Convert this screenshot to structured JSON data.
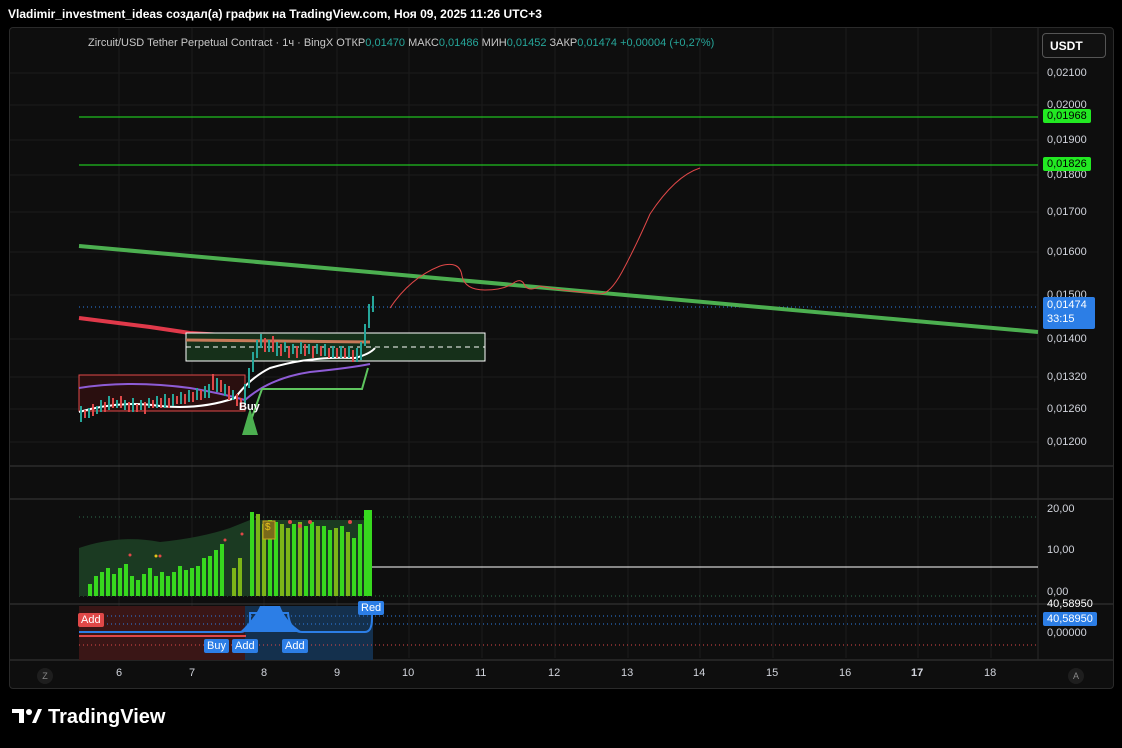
{
  "header": {
    "title": "Vladimir_investment_ideas создал(а) график на TradingView.com, Ноя 09, 2025 11:26 UTC+3"
  },
  "legend": {
    "symbol": "Zircuit/USD Tether Perpetual Contract · 1ч · BingX",
    "open_label": "ОТКР",
    "open": "0,01470",
    "high_label": "МАКС",
    "high": "0,01486",
    "low_label": "МИН",
    "low": "0,01452",
    "close_label": "ЗАКР",
    "close": "0,01474",
    "change": "+0,00004 (+0,27%)"
  },
  "currency_button": "USDT",
  "price_axis": {
    "ticks": [
      "0,02100",
      "0,02000",
      "0,01900",
      "0,01800",
      "0,01700",
      "0,01600",
      "0,01500",
      "0,01400",
      "0,01320",
      "0,01260",
      "0,01200"
    ],
    "tag_upper": "0,01968",
    "tag_lower": "0,01826",
    "current_price": "0,01474",
    "countdown": "33:15"
  },
  "indicator1_axis": {
    "ticks": [
      "20,00",
      "10,00",
      "0,00"
    ]
  },
  "indicator2_axis": {
    "value_top": "40,58950",
    "value_tag": "40,58950",
    "zero": "0,00000"
  },
  "time_axis": {
    "labels": [
      "6",
      "7",
      "8",
      "9",
      "10",
      "11",
      "12",
      "13",
      "14",
      "15",
      "16",
      "17",
      "18"
    ]
  },
  "signals": {
    "buy_main": "Buy",
    "add_left": "Add",
    "buy_lower": "Buy",
    "add_lower1": "Add",
    "add_lower2": "Add",
    "red_label": "Red",
    "dollar": "$"
  },
  "corners": {
    "left": "Z",
    "right": "A"
  },
  "footer": {
    "brand": "TradingView"
  },
  "colors": {
    "up": "#26a69a",
    "accent_green": "#22e922",
    "trend_green": "#4caf50",
    "blue": "#2c7ee6",
    "red": "#e04848"
  }
}
